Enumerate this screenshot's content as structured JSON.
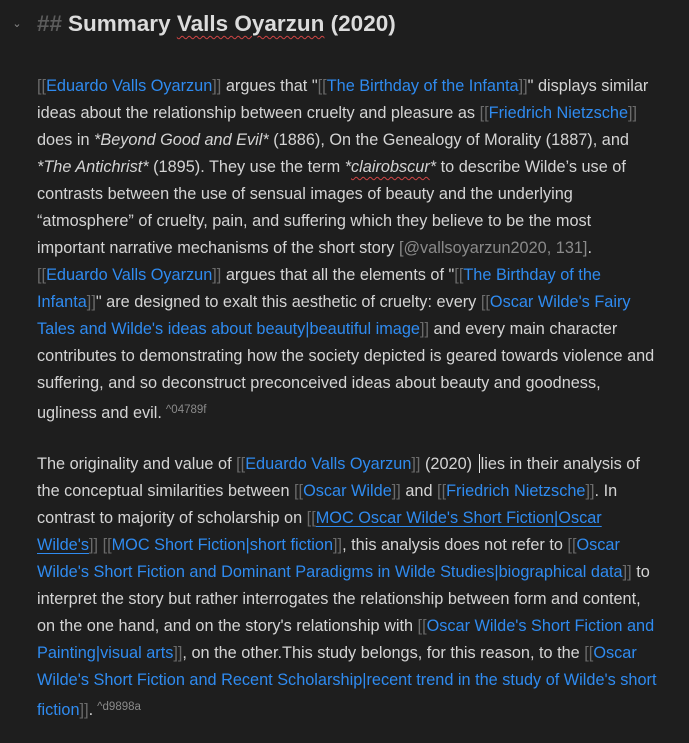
{
  "heading": {
    "marker": "##",
    "text_pre": "Summary ",
    "text_spell": "Valls Oyarzun",
    "text_post": " (2020)"
  },
  "brackets": {
    "open": "[[",
    "close": "]]"
  },
  "paragraph1": {
    "link_author": "Eduardo Valls Oyarzun",
    "t1": " argues that \"",
    "link_birthday": "The Birthday of the Infanta",
    "t2": "\" displays similar ideas about the relationship between cruelty and pleasure as ",
    "link_nietzsche": "Friedrich Nietzsche",
    "t3": " does in ",
    "em_beyond": "*Beyond Good and Evil*",
    "t4": " (1886), On the Genealogy of Morality (1887), and ",
    "em_antichrist": "*The Antichrist*",
    "t5": " (1895). They use the term ",
    "em_clair_open": "*",
    "em_clair": "clairobscur",
    "em_clair_close": "*",
    "t6": " to describe Wilde’s use of contrasts between the use of sensual images of beauty and the underlying “atmosphere” of cruelty, pain, and suffering which they believe to be the most important narrative mechanisms of the short story ",
    "citation": "[@vallsoyarzun2020, 131]",
    "t7": ". ",
    "link_author2": "Eduardo Valls Oyarzun",
    "t8": " argues that all the elements of \"",
    "link_birthday2": "The Birthday of the Infanta",
    "t9": "\" are designed to exalt this aesthetic of cruelty: every ",
    "link_fairy": "Oscar Wilde's Fairy Tales and Wilde's ideas about beauty|beautiful image",
    "t10": " and every main character contributes to demonstrating how the society depicted is geared towards violence and suffering, and so deconstruct preconceived ideas about beauty and goodness, ugliness and evil.",
    "block_id": "^04789f"
  },
  "paragraph2": {
    "t1": "The originality and value of ",
    "link_author": "Eduardo Valls Oyarzun",
    "t2a": " (2020) ",
    "t2b": "lies in their analysis of the conceptual similarities between ",
    "link_wilde": "Oscar Wilde",
    "t3": " and ",
    "link_nietzsche": "Friedrich Nietzsche",
    "t4": ". In contrast to majority of scholarship on ",
    "link_moc": "MOC Oscar Wilde's Short Fiction|Oscar Wilde's",
    "t5": " ",
    "link_moc_short": "MOC Short Fiction|short fiction",
    "t6": ", this analysis does not refer to ",
    "link_paradigms": "Oscar Wilde's Short Fiction and Dominant Paradigms in Wilde Studies|biographical data",
    "t7": " to interpret the story but rather interrogates the relationship between form and content, on the one hand, and on the story's relationship with ",
    "link_painting": "Oscar Wilde's Short Fiction and Painting|visual arts",
    "t8": ", on the other.This study belongs, for this reason, to the ",
    "link_recent": "Oscar Wilde's Short Fiction and Recent Scholarship|recent trend in the study of Wilde's short fiction",
    "t9": ".",
    "block_id": "^d9898a"
  }
}
